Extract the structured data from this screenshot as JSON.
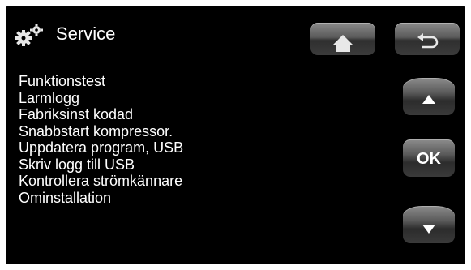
{
  "header": {
    "title": "Service",
    "icon": "gears-icon",
    "home_icon": "home-icon",
    "back_icon": "back-arrow-icon"
  },
  "menu": {
    "items": [
      {
        "label": "Funktionstest"
      },
      {
        "label": "Larmlogg"
      },
      {
        "label": "Fabriksinst kodad"
      },
      {
        "label": "Snabbstart kompressor."
      },
      {
        "label": "Uppdatera program, USB"
      },
      {
        "label": "Skriv logg till USB"
      },
      {
        "label": "Kontrollera strömkännare"
      },
      {
        "label": "Ominstallation"
      }
    ]
  },
  "side_buttons": {
    "up_icon": "triangle-up-icon",
    "ok_label": "OK",
    "down_icon": "triangle-down-icon"
  },
  "colors": {
    "background": "#000000",
    "text": "#ffffff",
    "button_top": "#8c8c8c",
    "button_bottom": "#2c2c2c"
  }
}
